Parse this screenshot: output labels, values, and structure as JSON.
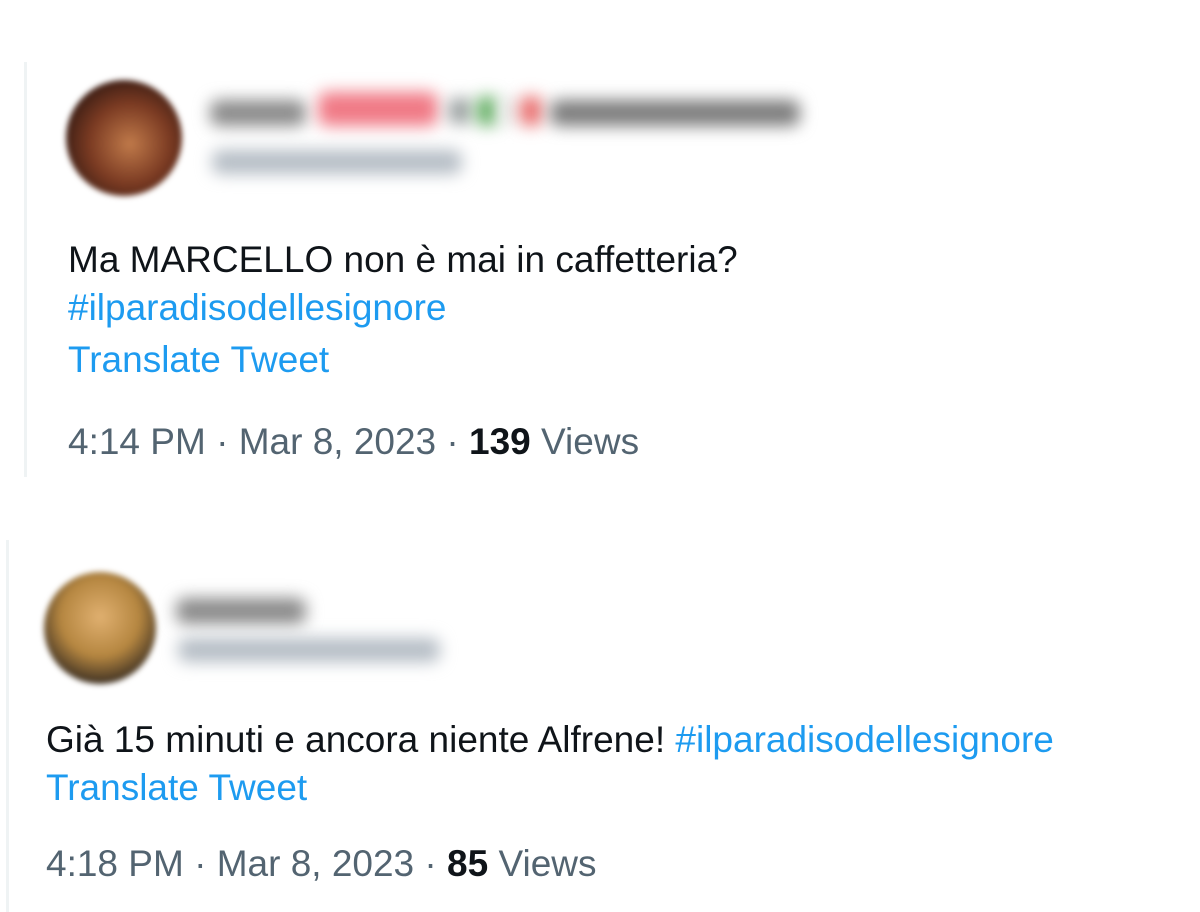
{
  "tweets": [
    {
      "text": "Ma MARCELLO non è mai in caffetteria?",
      "hashtag": "#ilparadisodellesignore",
      "translate_label": "Translate Tweet",
      "time": "4:14 PM",
      "separator": " · ",
      "date": "Mar 8, 2023",
      "views_count": "139",
      "views_label": " Views"
    },
    {
      "text": "Già 15 minuti e ancora niente Alfrene! ",
      "hashtag": "#ilparadisodellesignore",
      "translate_label": "Translate Tweet",
      "time": "4:18 PM",
      "separator": " · ",
      "date": "Mar 8, 2023",
      "views_count": "85",
      "views_label": " Views"
    }
  ],
  "colors": {
    "link": "#1d9bf0",
    "text": "#0f1419",
    "muted": "#536471"
  }
}
